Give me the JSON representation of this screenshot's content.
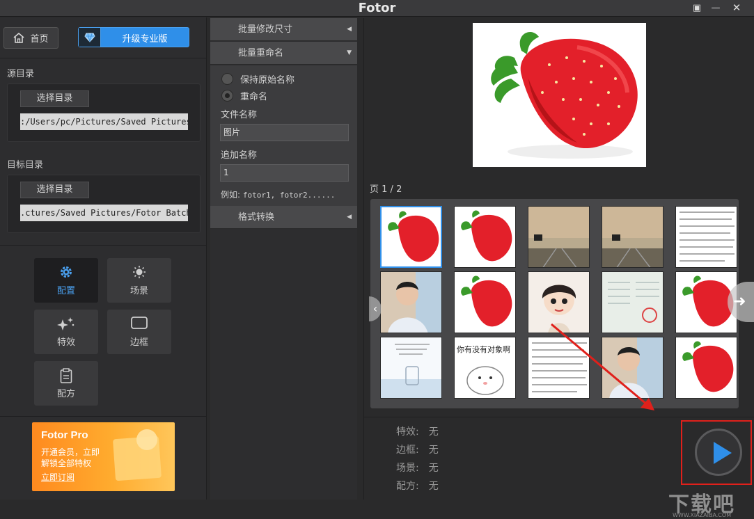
{
  "window": {
    "title": "Fotor"
  },
  "left": {
    "home_label": "首页",
    "upgrade_label": "升级专业版",
    "source": {
      "label": "源目录",
      "choose_label": "选择目录",
      "path": ":/Users/pc/Pictures/Saved Pictures"
    },
    "target": {
      "label": "目标目录",
      "choose_label": "选择目录",
      "path": ".ctures/Saved Pictures/Fotor Batch"
    },
    "tools": [
      {
        "label": "配置",
        "icon": "gear-icon"
      },
      {
        "label": "场景",
        "icon": "sun-icon"
      },
      {
        "label": "特效",
        "icon": "sparkle-icon"
      },
      {
        "label": "边框",
        "icon": "frame-icon"
      },
      {
        "label": "配方",
        "icon": "clipboard-icon"
      }
    ],
    "promo": {
      "title": "Fotor Pro",
      "line1": "开通会员，立即",
      "line2": "解锁全部特权",
      "subscribe": "立即订阅"
    }
  },
  "middle": {
    "resize_label": "批量修改尺寸",
    "rename_label": "批量重命名",
    "keep_name_label": "保持原始名称",
    "rename_option_label": "重命名",
    "file_name_label": "文件名称",
    "file_name_value": "图片",
    "append_label": "追加名称",
    "append_value": "1",
    "example_prefix": "例如:",
    "example_value": "fotor1, fotor2......",
    "format_label": "格式转换"
  },
  "right": {
    "page_label": "页",
    "page_value": "1 / 2",
    "summary": [
      {
        "label": "特效:",
        "value": "无"
      },
      {
        "label": "边框:",
        "value": "无"
      },
      {
        "label": "场景:",
        "value": "无"
      },
      {
        "label": "配方:",
        "value": "无"
      }
    ],
    "thumbnails": [
      "strawberry",
      "strawberry",
      "road",
      "road",
      "document",
      "person",
      "strawberry",
      "cartoon-girl",
      "certificate",
      "strawberry",
      "glass-jar",
      "hamster-meme",
      "document",
      "person",
      "strawberry"
    ],
    "meme_text": "你有没有对象啊"
  },
  "watermark": {
    "text": "下载吧",
    "sub": "WWW.XIAZAIBA.COM"
  },
  "colors": {
    "accent": "#2f8fe9",
    "highlight": "#e0201b",
    "background": "#2a2a2b"
  }
}
